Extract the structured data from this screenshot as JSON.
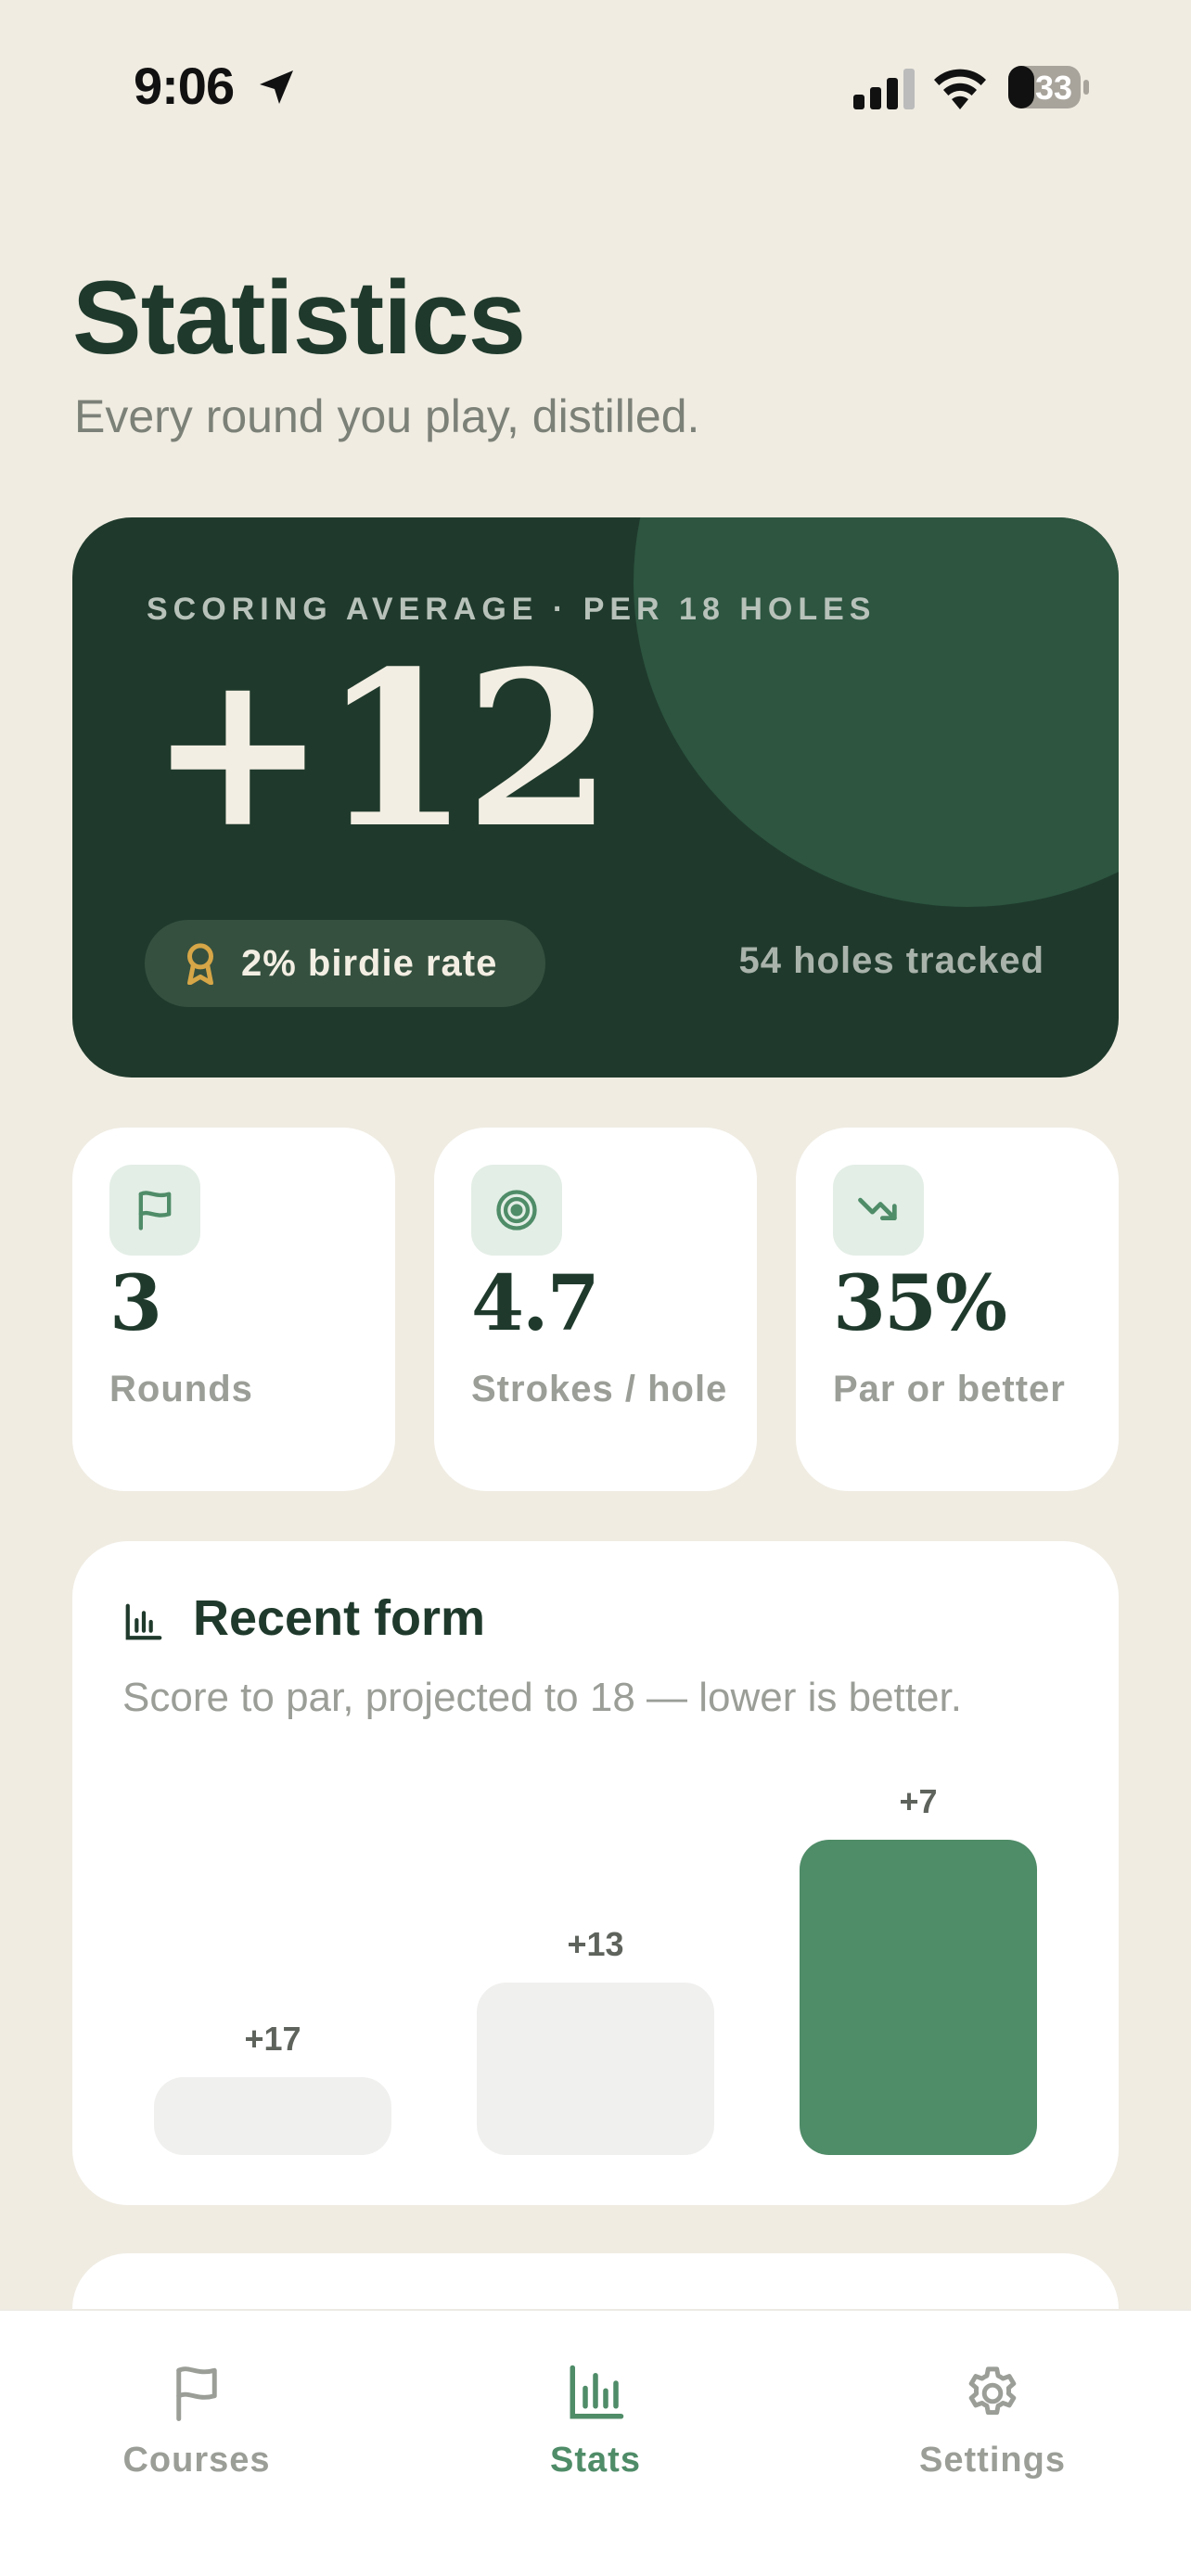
{
  "status_bar": {
    "time": "9:06",
    "battery": "33"
  },
  "header": {
    "title": "Statistics",
    "subtitle": "Every round you play, distilled."
  },
  "hero": {
    "label": "SCORING AVERAGE · PER 18 HOLES",
    "value": "+12",
    "birdie_rate": "2% birdie rate",
    "holes_tracked": "54 holes tracked"
  },
  "stats": [
    {
      "icon": "flag-icon",
      "value": "3",
      "label": "Rounds"
    },
    {
      "icon": "target-icon",
      "value": "4.7",
      "label": "Strokes / hole"
    },
    {
      "icon": "trend-down-icon",
      "value": "35%",
      "label": "Par or better"
    }
  ],
  "recent_form": {
    "title": "Recent form",
    "subtitle": "Score to par, projected to 18 — lower is better."
  },
  "chart_data": {
    "type": "bar",
    "title": "Recent form",
    "categories": [
      "",
      "",
      ""
    ],
    "values": [
      17,
      13,
      7
    ],
    "labels": [
      "+17",
      "+13",
      "+7"
    ],
    "highlight_index": 2,
    "colors": {
      "default": "#F0F1EF",
      "highlight": "#4F8C68"
    }
  },
  "tab_bar": {
    "items": [
      {
        "label": "Courses",
        "icon": "flag-icon",
        "active": false
      },
      {
        "label": "Stats",
        "icon": "bar-chart-icon",
        "active": true
      },
      {
        "label": "Settings",
        "icon": "gear-icon",
        "active": false
      }
    ]
  },
  "colors": {
    "background": "#F0ECE2",
    "primary_dark": "#1F3A2C",
    "accent_green": "#4F8C68",
    "gold": "#D6A647"
  }
}
